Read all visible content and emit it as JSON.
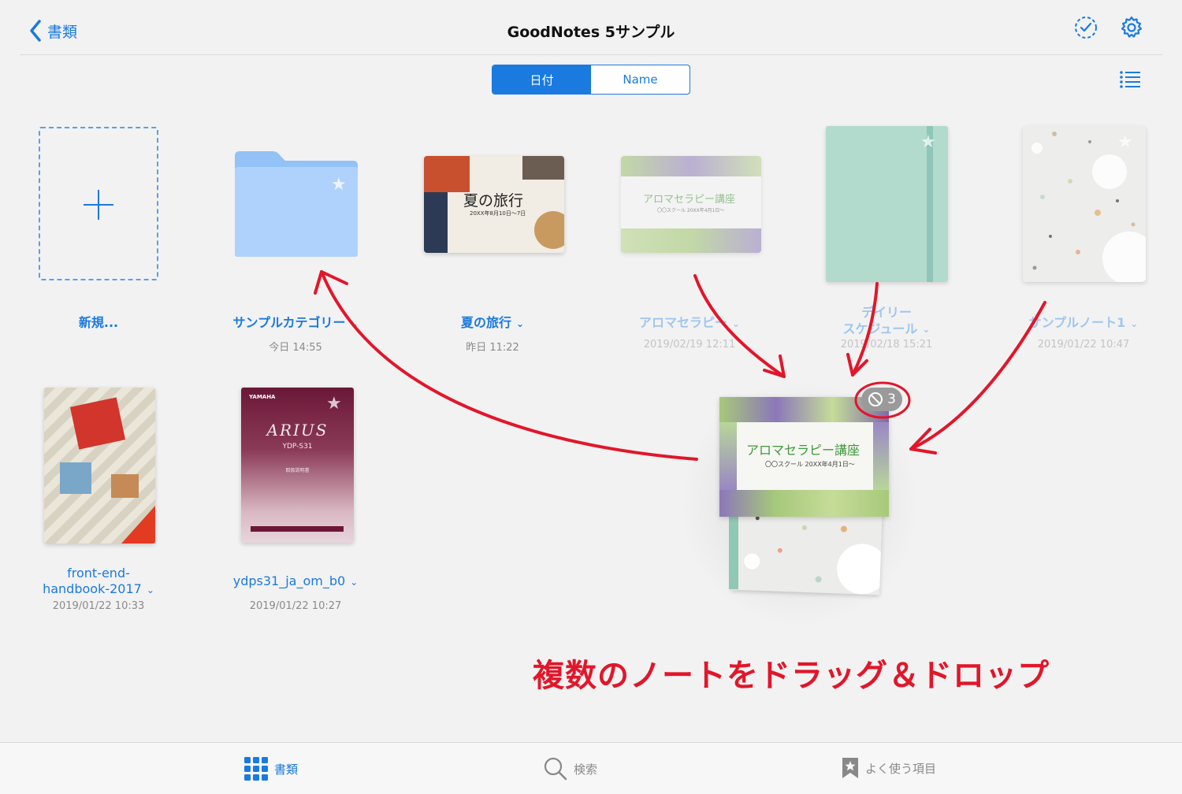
{
  "header": {
    "back_label": "書類",
    "title": "GoodNotes 5サンプル"
  },
  "sort": {
    "options": [
      "日付",
      "Name"
    ],
    "selected": "日付"
  },
  "new_item": {
    "label": "新規..."
  },
  "items": [
    {
      "title": "サンプルカテゴリー",
      "date": "今日 14:55",
      "kind": "folder"
    },
    {
      "title": "夏の旅行",
      "date": "昨日 11:22",
      "cover_text": "夏の旅行",
      "cover_sub": "20XX年8月10日〜7日"
    },
    {
      "title": "アロマセラピー",
      "date": "2019/02/19 12:11",
      "cover_text": "アロマセラピー講座",
      "cover_sub": "〇〇スクール 20XX年4月1日〜"
    },
    {
      "title_line1": "デイリー",
      "title_line2": "スケジュール",
      "date": "2019/02/18 15:21"
    },
    {
      "title": "サンプルノート1",
      "date": "2019/01/22 10:47"
    },
    {
      "title_line1": "front-end-",
      "title_line2": "handbook-2017",
      "date": "2019/01/22 10:33"
    },
    {
      "title": "ydps31_ja_om_b0",
      "date": "2019/01/22 10:27",
      "cover_brand": "YAMAHA",
      "cover_text": "ARIUS",
      "cover_sub": "YDP-S31",
      "cover_small": "取扱説明書"
    }
  ],
  "drag": {
    "badge_count": "3",
    "cover_text": "アロマセラピー講座",
    "cover_sub": "〇〇スクール 20XX年4月1日〜"
  },
  "caption": "複数のノートをドラッグ＆ドロップ",
  "tabs": [
    {
      "label": "書類",
      "icon": "grid-icon",
      "active": true
    },
    {
      "label": "検索",
      "icon": "search-icon",
      "active": false
    },
    {
      "label": "よく使う項目",
      "icon": "bookmark-star-icon",
      "active": false
    }
  ],
  "colors": {
    "accent": "#1a7ae0",
    "annotation": "#e2162a",
    "folder": "#a9d0fb",
    "teal_note": "#b2ddd0"
  }
}
